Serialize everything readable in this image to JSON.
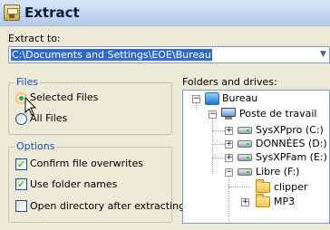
{
  "window": {
    "title": "Extract",
    "icon": "archive-icon"
  },
  "extract_to": {
    "label": "Extract to:",
    "path": "C:\\Documents and Settings\\EOE\\Bureau"
  },
  "files_group": {
    "title": "Files",
    "selected_label": "Selected Files",
    "all_label": "All Files",
    "selected": "Selected Files"
  },
  "options_group": {
    "title": "Options",
    "confirm_overwrites": {
      "label": "Confirm file overwrites",
      "checked": true
    },
    "use_folder_names": {
      "label": "Use folder names",
      "checked": true
    },
    "open_directory": {
      "label": "Open directory after extracting",
      "checked": false
    }
  },
  "folders": {
    "label": "Folders and drives:",
    "items": [
      {
        "label": "Bureau",
        "icon": "desktop-icon",
        "expander": "minus"
      },
      {
        "label": "Poste de travail",
        "icon": "my-computer-icon",
        "expander": "minus"
      },
      {
        "label": "SysXPpro (C:)",
        "icon": "drive-icon",
        "expander": "plus"
      },
      {
        "label": "DONNÉES (D:)",
        "icon": "drive-icon",
        "expander": "plus"
      },
      {
        "label": "SysXPFam (E:)",
        "icon": "drive-icon",
        "expander": "plus"
      },
      {
        "label": "Libre (F:)",
        "icon": "drive-icon",
        "expander": "minus"
      },
      {
        "label": "clipper",
        "icon": "folder-icon",
        "expander": "none"
      },
      {
        "label": "MP3",
        "icon": "folder-icon",
        "expander": "plus"
      }
    ]
  }
}
